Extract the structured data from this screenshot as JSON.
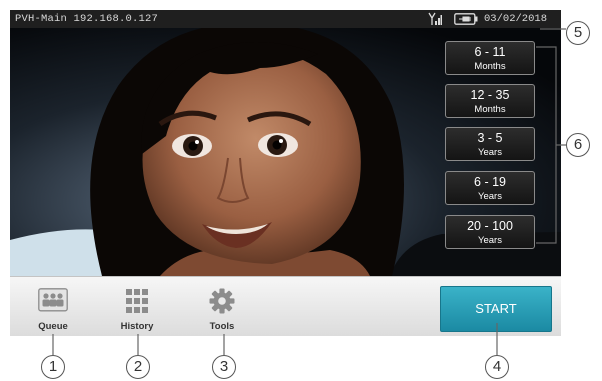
{
  "status_bar": {
    "device_label": "PVH-Main 192.168.0.127",
    "date": "03/02/2018",
    "signal_icon": "antenna-signal-icon",
    "battery_icon": "battery-plug-icon"
  },
  "age_buttons": [
    {
      "range": "6 - 11",
      "unit": "Months"
    },
    {
      "range": "12 - 35",
      "unit": "Months"
    },
    {
      "range": "3 - 5",
      "unit": "Years"
    },
    {
      "range": "6 - 19",
      "unit": "Years"
    },
    {
      "range": "20 - 100",
      "unit": "Years"
    }
  ],
  "toolbar": {
    "queue_label": "Queue",
    "history_label": "History",
    "tools_label": "Tools",
    "start_label": "START"
  },
  "callouts": [
    "1",
    "2",
    "3",
    "4",
    "5",
    "6"
  ],
  "colors": {
    "start_button": "#2aa0b8",
    "status_bar": "#1f1f1f",
    "toolbar": "#e8e8e8"
  }
}
